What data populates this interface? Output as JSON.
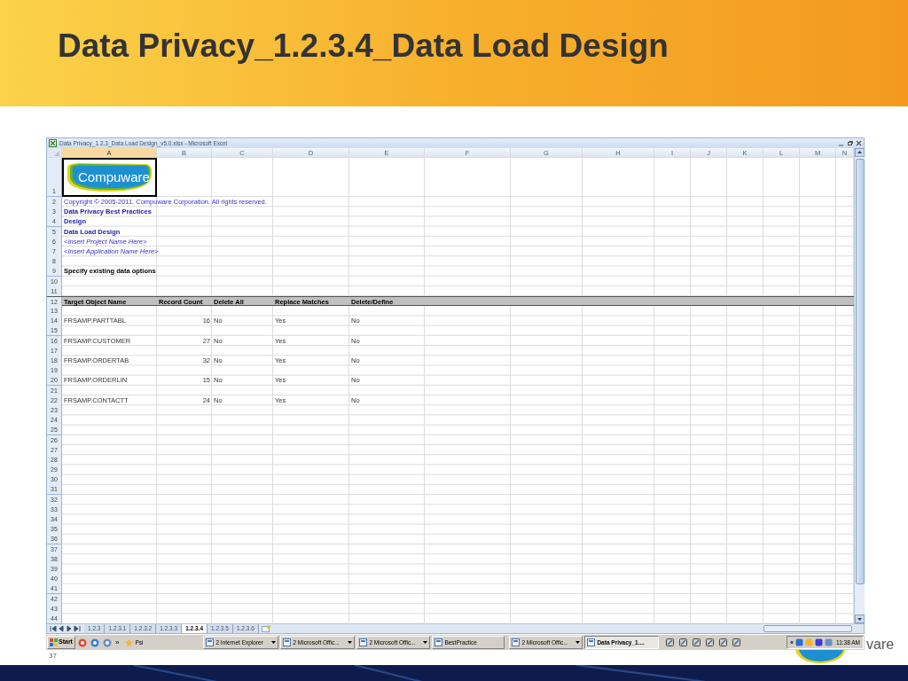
{
  "slide": {
    "title": "Data Privacy_1.2.3.4_Data Load Design",
    "page_number": "37",
    "logo_fragment": "vare"
  },
  "window": {
    "title": "Data Privacy_1.2.3_Data Load Design_v5.0.xlsx - Microsoft Excel"
  },
  "columns": [
    {
      "label": "A",
      "selected": true
    },
    {
      "label": "B",
      "selected": false
    },
    {
      "label": "C",
      "selected": false
    },
    {
      "label": "D",
      "selected": false
    },
    {
      "label": "E",
      "selected": false
    },
    {
      "label": "F",
      "selected": false
    },
    {
      "label": "G",
      "selected": false
    },
    {
      "label": "H",
      "selected": false
    },
    {
      "label": "I",
      "selected": false
    },
    {
      "label": "J",
      "selected": false
    },
    {
      "label": "K",
      "selected": false
    },
    {
      "label": "L",
      "selected": false
    },
    {
      "label": "M",
      "selected": false
    },
    {
      "label": "N",
      "selected": false
    }
  ],
  "rows": [
    {
      "number": "1",
      "kind": "logo",
      "logo_text": "Compuware",
      "selected": true
    },
    {
      "number": "2",
      "kind": "copyright",
      "cells": [
        {
          "text": "Copyright © 2005-2011. Compuware Corporation.  All rights reserved.",
          "kind": "text"
        }
      ]
    },
    {
      "number": "3",
      "kind": "title",
      "cells": [
        {
          "text": "Data Privacy Best Practices",
          "kind": "text"
        }
      ]
    },
    {
      "number": "4",
      "kind": "title",
      "cells": [
        {
          "text": "Design",
          "kind": "text"
        }
      ]
    },
    {
      "number": "5",
      "kind": "title",
      "cells": [
        {
          "text": "Data Load Design",
          "kind": "text"
        }
      ]
    },
    {
      "number": "6",
      "kind": "placeholder",
      "cells": [
        {
          "text": "<Insert Project Name Here>",
          "kind": "text"
        }
      ]
    },
    {
      "number": "7",
      "kind": "placeholder",
      "cells": [
        {
          "text": "<Insert Application Name Here>",
          "kind": "text"
        }
      ]
    },
    {
      "number": "8",
      "kind": "empty"
    },
    {
      "number": "9",
      "kind": "label",
      "cells": [
        {
          "text": "Specify existing data options",
          "kind": "text"
        }
      ]
    },
    {
      "number": "10",
      "kind": "empty"
    },
    {
      "number": "11",
      "kind": "empty"
    },
    {
      "number": "12",
      "kind": "header",
      "cells": [
        {
          "text": "Target Object Name",
          "kind": "text"
        },
        {
          "text": "Record Count",
          "kind": "text"
        },
        {
          "text": "Delete All",
          "kind": "text"
        },
        {
          "text": "Replace Matches",
          "kind": "text"
        },
        {
          "text": "Delete/Define",
          "kind": "text"
        }
      ]
    },
    {
      "number": "13",
      "kind": "empty"
    },
    {
      "number": "14",
      "kind": "data",
      "cells": [
        {
          "text": "FRSAMP.PARTTABL",
          "kind": "text"
        },
        {
          "text": "16",
          "kind": "number"
        },
        {
          "text": "No",
          "kind": "text"
        },
        {
          "text": "Yes",
          "kind": "text"
        },
        {
          "text": "No",
          "kind": "text"
        }
      ]
    },
    {
      "number": "15",
      "kind": "empty"
    },
    {
      "number": "16",
      "kind": "data",
      "cells": [
        {
          "text": "FRSAMP.CUSTOMER",
          "kind": "text"
        },
        {
          "text": "27",
          "kind": "number"
        },
        {
          "text": "No",
          "kind": "text"
        },
        {
          "text": "Yes",
          "kind": "text"
        },
        {
          "text": "No",
          "kind": "text"
        }
      ]
    },
    {
      "number": "17",
      "kind": "empty"
    },
    {
      "number": "18",
      "kind": "data",
      "cells": [
        {
          "text": "FRSAMP.ORDERTAB",
          "kind": "text"
        },
        {
          "text": "32",
          "kind": "number"
        },
        {
          "text": "No",
          "kind": "text"
        },
        {
          "text": "Yes",
          "kind": "text"
        },
        {
          "text": "No",
          "kind": "text"
        }
      ]
    },
    {
      "number": "19",
      "kind": "empty"
    },
    {
      "number": "20",
      "kind": "data",
      "cells": [
        {
          "text": "FRSAMP.ORDERLIN",
          "kind": "text"
        },
        {
          "text": "15",
          "kind": "number"
        },
        {
          "text": "No",
          "kind": "text"
        },
        {
          "text": "Yes",
          "kind": "text"
        },
        {
          "text": "No",
          "kind": "text"
        }
      ]
    },
    {
      "number": "21",
      "kind": "empty"
    },
    {
      "number": "22",
      "kind": "data",
      "cells": [
        {
          "text": "FRSAMP.CONTACTT",
          "kind": "text"
        },
        {
          "text": "24",
          "kind": "number"
        },
        {
          "text": "No",
          "kind": "text"
        },
        {
          "text": "Yes",
          "kind": "text"
        },
        {
          "text": "No",
          "kind": "text"
        }
      ]
    },
    {
      "number": "23",
      "kind": "empty"
    },
    {
      "number": "24",
      "kind": "empty"
    },
    {
      "number": "25",
      "kind": "empty"
    },
    {
      "number": "26",
      "kind": "empty"
    },
    {
      "number": "27",
      "kind": "empty"
    },
    {
      "number": "28",
      "kind": "empty"
    },
    {
      "number": "29",
      "kind": "empty"
    },
    {
      "number": "30",
      "kind": "empty"
    },
    {
      "number": "31",
      "kind": "empty"
    },
    {
      "number": "32",
      "kind": "empty"
    },
    {
      "number": "33",
      "kind": "empty"
    },
    {
      "number": "34",
      "kind": "empty"
    },
    {
      "number": "35",
      "kind": "empty"
    },
    {
      "number": "36",
      "kind": "empty"
    },
    {
      "number": "37",
      "kind": "empty"
    },
    {
      "number": "38",
      "kind": "empty"
    },
    {
      "number": "39",
      "kind": "empty"
    },
    {
      "number": "40",
      "kind": "empty"
    },
    {
      "number": "41",
      "kind": "empty"
    },
    {
      "number": "42",
      "kind": "empty"
    },
    {
      "number": "43",
      "kind": "empty"
    },
    {
      "number": "44",
      "kind": "empty"
    }
  ],
  "sheet_tabs": [
    {
      "label": "1.2.3",
      "selected": false
    },
    {
      "label": "1.2.3.1",
      "selected": false
    },
    {
      "label": "1.2.3.2",
      "selected": false
    },
    {
      "label": "1.2.3.3",
      "selected": false
    },
    {
      "label": "1.2.3.4",
      "selected": true
    },
    {
      "label": "1.2.3.5",
      "selected": false
    },
    {
      "label": "1.2.3.6",
      "selected": false
    }
  ],
  "taskbar": {
    "start": "Start",
    "more": "»",
    "items": [
      {
        "label": "Psi",
        "kind": "toolbar",
        "selected": false
      },
      {
        "label": "2 Internet Explorer",
        "kind": "group",
        "selected": false
      },
      {
        "label": "2 Microsoft Offic...",
        "kind": "group",
        "selected": false
      },
      {
        "label": "2 Microsoft Offic...",
        "kind": "group",
        "selected": false
      },
      {
        "label": "BestPractice",
        "kind": "window",
        "selected": false
      },
      {
        "label": "2 Microsoft Offic...",
        "kind": "group",
        "selected": false
      },
      {
        "label": "Data Privacy_1....",
        "kind": "window",
        "selected": true
      }
    ],
    "tray_expand": "«",
    "clock": "11:38 AM"
  }
}
